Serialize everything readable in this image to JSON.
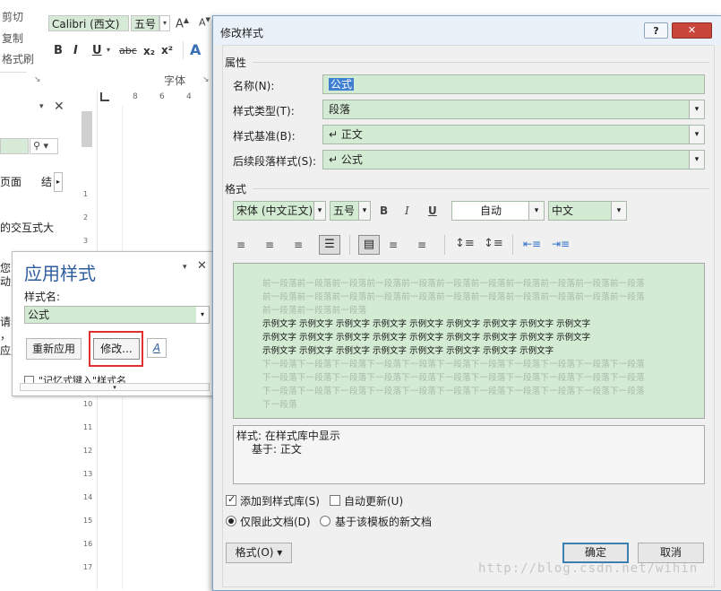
{
  "ribbon": {
    "cut": "剪切",
    "copy": "复制",
    "format_painter": "格式刷",
    "font_name": "Calibri (西文)",
    "font_size": "五号",
    "font_group_label": "字体",
    "bold": "B",
    "italic": "I",
    "underline": "U",
    "strike": "abc",
    "sub": "x₂",
    "sup": "x²"
  },
  "left_pane": {
    "search_value": "",
    "item_page": "页面",
    "item_result": "结",
    "text_interactive": "的交互式大",
    "frag1": "您自",
    "frag2": "动户",
    "frag3": "请单",
    "frag4": "，",
    "frag5": "应月"
  },
  "ruler": {
    "h_marks": [
      "8",
      "6",
      "4"
    ],
    "v_marks": [
      "1",
      "2",
      "3",
      "4",
      "5",
      "6",
      "7",
      "8",
      "9",
      "10",
      "11",
      "12",
      "13",
      "14",
      "15",
      "16",
      "17"
    ]
  },
  "apply_styles": {
    "title": "应用样式",
    "style_name_label": "样式名:",
    "style_name_value": "公式",
    "reapply": "重新应用",
    "modify": "修改...",
    "styles_icon_text": "A",
    "autocomplete": "\"记忆式键入\"样式名"
  },
  "dialog": {
    "title": "修改样式",
    "help": "?",
    "properties_group": "属性",
    "name_label": "名称(N):",
    "name_value": "公式",
    "type_label": "样式类型(T):",
    "type_value": "段落",
    "based_label": "样式基准(B):",
    "based_value": "↵ 正文",
    "next_label": "后续段落样式(S):",
    "next_value": "↵ 公式",
    "format_group": "格式",
    "font_value": "宋体 (中文正文)",
    "size_value": "五号",
    "bold": "B",
    "italic": "I",
    "underline": "U",
    "color_value": "自动",
    "lang_value": "中文",
    "preview_prev": "前一段落前一段落前一段落前一段落前一段落前一段落前一段落前一段落前一段落前一段落前一段落",
    "preview_prev_short": "前一段落前一段落前一段落前一段落前一段落前一段落前一段落前一段落前一段落前一段落前一段落",
    "preview_prev_end": "前一段落前一段落前一段落",
    "sample1": "示例文字  示例文字  示例文字  示例文字  示例文字  示例文字  示例文字  示例文字  示例文字",
    "sample2": "示例文字  示例文字  示例文字  示例文字  示例文字  示例文字  示例文字  示例文字  示例文字",
    "sample3": "示例文字  示例文字  示例文字  示例文字  示例文字  示例文字  示例文字  示例文字",
    "preview_next": "下一段落下一段落下一段落下一段落下一段落下一段落下一段落下一段落下一段落下一段落下一段落",
    "preview_next_end": "下一段落",
    "desc_line1": "样式: 在样式库中显示",
    "desc_line2": "基于: 正文",
    "add_to_gallery": "添加到样式库(S)",
    "auto_update": "自动更新(U)",
    "only_this_doc": "仅限此文档(D)",
    "new_docs": "基于该模板的新文档",
    "format_button": "格式(O) ▾",
    "ok": "确定",
    "cancel": "取消"
  },
  "watermark": "http://blog.csdn.net/wihin"
}
